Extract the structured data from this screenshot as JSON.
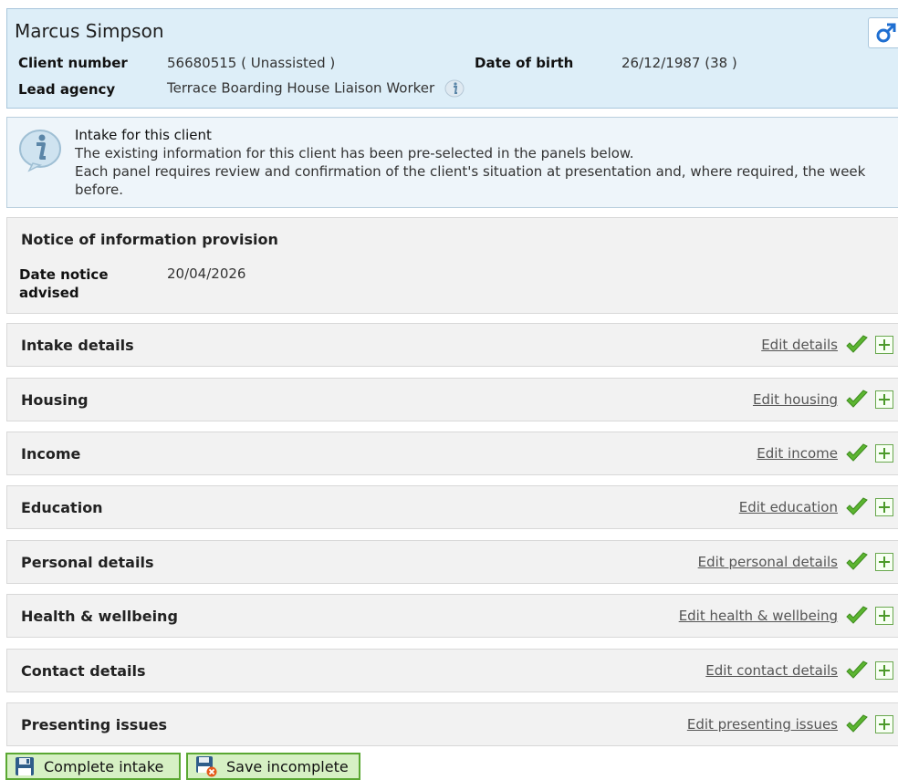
{
  "client": {
    "name": "Marcus Simpson",
    "client_number_label": "Client number",
    "client_number_value": "56680515 ( Unassisted )",
    "dob_label": "Date of birth",
    "dob_value": "26/12/1987 (38 )",
    "lead_agency_label": "Lead agency",
    "lead_agency_value": "Terrace Boarding House Liaison Worker",
    "gender_icon": "male-symbol-icon"
  },
  "intake_info": {
    "title": "Intake for this client",
    "line1": "The existing information for this client has been pre-selected in the panels below.",
    "line2": "Each panel requires review and confirmation of the client's situation at presentation and, where required, the week",
    "line3": "before."
  },
  "notice": {
    "title": "Notice of information provision",
    "date_label": "Date notice advised",
    "date_value": "20/04/2026"
  },
  "sections": [
    {
      "title": "Intake details",
      "link": "Edit details"
    },
    {
      "title": "Housing",
      "link": "Edit housing"
    },
    {
      "title": "Income",
      "link": "Edit income"
    },
    {
      "title": "Education",
      "link": "Edit education"
    },
    {
      "title": "Personal details",
      "link": "Edit personal details"
    },
    {
      "title": "Health & wellbeing",
      "link": "Edit health & wellbeing"
    },
    {
      "title": "Contact details",
      "link": "Edit contact details"
    },
    {
      "title": "Presenting issues",
      "link": "Edit presenting issues"
    }
  ],
  "actions": {
    "complete_label": "Complete intake",
    "save_label": "Save incomplete"
  },
  "colors": {
    "header_bg": "#ddeef8",
    "panel_bg": "#f2f2f2",
    "button_bg": "#d6f0c4",
    "button_border": "#5aa832",
    "check_green": "#5cb531"
  }
}
